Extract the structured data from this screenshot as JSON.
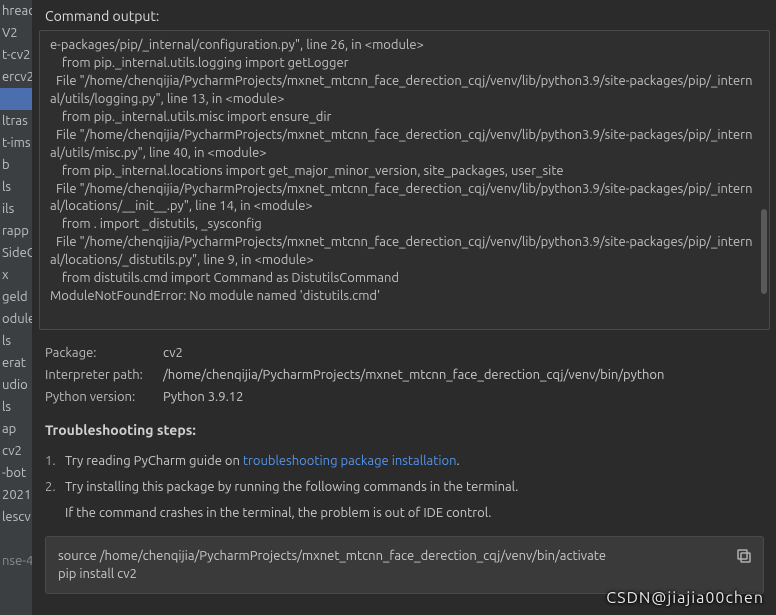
{
  "sidebar": {
    "items": [
      {
        "label": "hread",
        "sel": false
      },
      {
        "label": "V2",
        "sel": false
      },
      {
        "label": "t-cv2",
        "sel": false
      },
      {
        "label": "ercv2",
        "sel": false
      },
      {
        "label": "",
        "sel": true
      },
      {
        "label": "ltras",
        "sel": false
      },
      {
        "label": "t-ims",
        "sel": false
      },
      {
        "label": "b",
        "sel": false
      },
      {
        "label": "ls",
        "sel": false
      },
      {
        "label": "ils",
        "sel": false
      },
      {
        "label": "rapp",
        "sel": false
      },
      {
        "label": "SideC",
        "sel": false
      },
      {
        "label": "x",
        "sel": false
      },
      {
        "label": "geld",
        "sel": false
      },
      {
        "label": "odule",
        "sel": false
      },
      {
        "label": "ls",
        "sel": false
      },
      {
        "label": "erat",
        "sel": false
      },
      {
        "label": "udio",
        "sel": false
      },
      {
        "label": "ls",
        "sel": false
      },
      {
        "label": "ap",
        "sel": false
      },
      {
        "label": "cv2",
        "sel": false
      },
      {
        "label": "-bot",
        "sel": false
      },
      {
        "label": "2021",
        "sel": false
      },
      {
        "label": "lescv",
        "sel": false
      },
      {
        "label": "",
        "sel": false,
        "spacer": true
      },
      {
        "label": "nse-4",
        "sel": false,
        "light": true
      }
    ]
  },
  "header": {
    "title": "Command output:"
  },
  "output": {
    "text": "e-packages/pip/_internal/configuration.py\", line 26, in <module>\n    from pip._internal.utils.logging import getLogger\n  File \"/home/chenqijia/PycharmProjects/mxnet_mtcnn_face_derection_cqj/venv/lib/python3.9/site-packages/pip/_internal/utils/logging.py\", line 13, in <module>\n    from pip._internal.utils.misc import ensure_dir\n  File \"/home/chenqijia/PycharmProjects/mxnet_mtcnn_face_derection_cqj/venv/lib/python3.9/site-packages/pip/_internal/utils/misc.py\", line 40, in <module>\n    from pip._internal.locations import get_major_minor_version, site_packages, user_site\n  File \"/home/chenqijia/PycharmProjects/mxnet_mtcnn_face_derection_cqj/venv/lib/python3.9/site-packages/pip/_internal/locations/__init__.py\", line 14, in <module>\n    from . import _distutils, _sysconfig\n  File \"/home/chenqijia/PycharmProjects/mxnet_mtcnn_face_derection_cqj/venv/lib/python3.9/site-packages/pip/_internal/locations/_distutils.py\", line 9, in <module>\n    from distutils.cmd import Command as DistutilsCommand\nModuleNotFoundError: No module named 'distutils.cmd'"
  },
  "kv": {
    "package_key": "Package:",
    "package_val": "cv2",
    "interp_key": "Interpreter path:",
    "interp_val": "/home/chenqijia/PycharmProjects/mxnet_mtcnn_face_derection_cqj/venv/bin/python",
    "pyver_key": "Python version:",
    "pyver_val": "Python 3.9.12"
  },
  "troubleshoot": {
    "title": "Troubleshooting steps:",
    "steps": [
      {
        "num": "1.",
        "pre": "Try reading PyCharm guide on ",
        "link": "troubleshooting package installation",
        "post": "."
      },
      {
        "num": "2.",
        "pre": "Try installing this package by running the following commands in the terminal."
      }
    ],
    "subtext": "If the command crashes in the terminal, the problem is out of IDE control."
  },
  "cmd": {
    "text": "source /home/chenqijia/PycharmProjects/mxnet_mtcnn_face_derection_cqj/venv/bin/activate\npip install cv2"
  },
  "watermark": "CSDN@jiajia00chen"
}
